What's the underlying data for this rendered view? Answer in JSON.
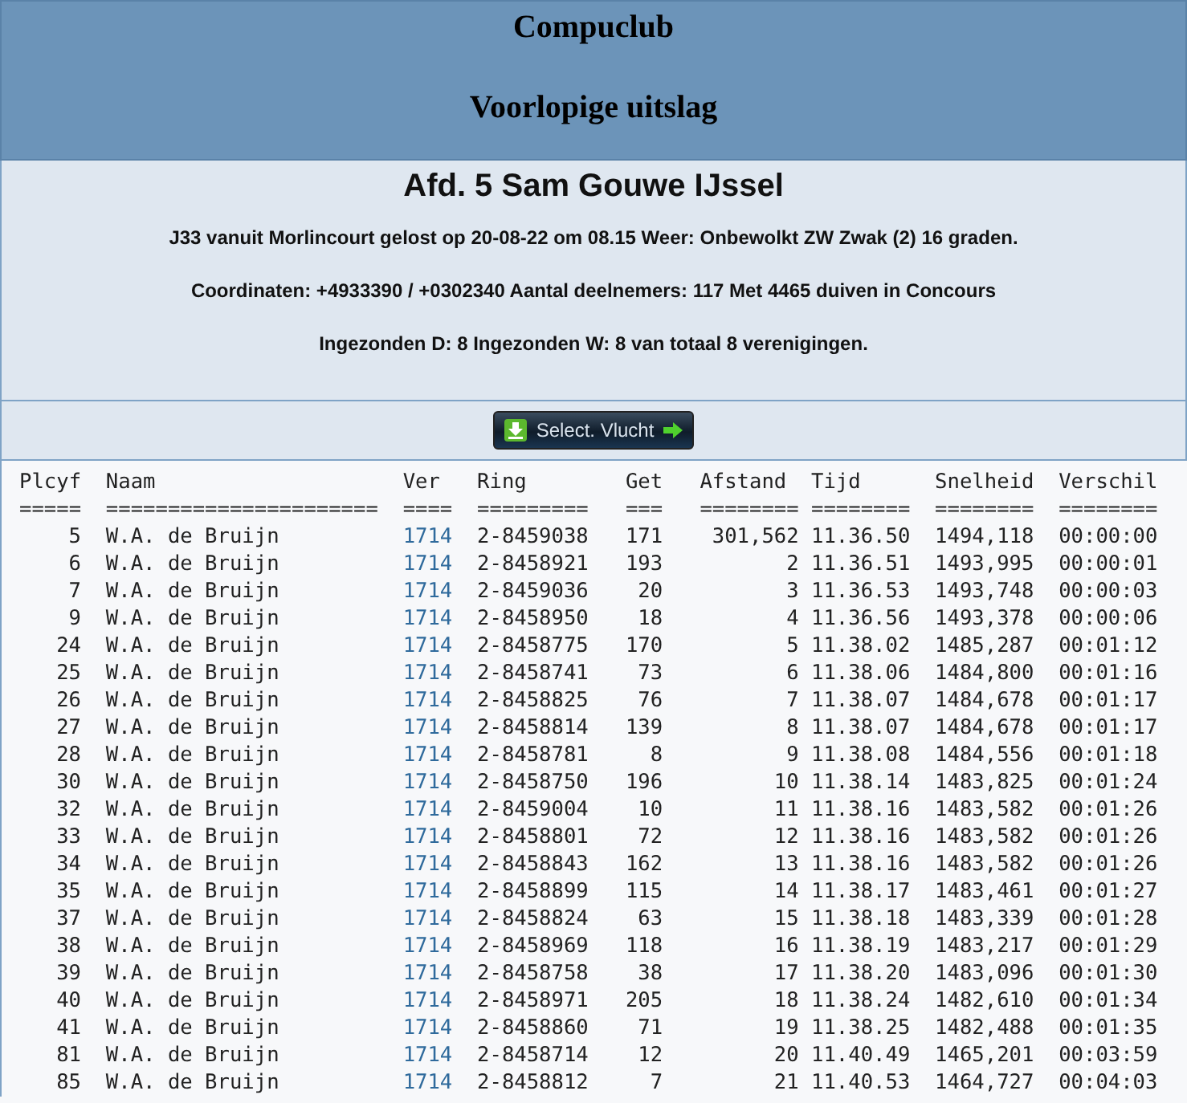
{
  "header": {
    "title": "Compuclub",
    "subtitle": "Voorlopige uitslag"
  },
  "info": {
    "title": "Afd. 5 Sam Gouwe IJssel",
    "lines": [
      "J33 vanuit Morlincourt gelost op 20-08-22 om 08.15 Weer: Onbewolkt ZW Zwak (2) 16 graden.",
      "Coordinaten: +4933390 / +0302340 Aantal deelnemers: 117 Met 4465 duiven in Concours",
      "Ingezonden D: 8 Ingezonden W: 8 van totaal 8 verenigingen."
    ]
  },
  "select_button": {
    "label": "Select. Vlucht"
  },
  "table": {
    "columns": [
      {
        "label": "Plcyf",
        "rule": "=====",
        "kind": "text"
      },
      {
        "label": "Naam",
        "rule": "======================",
        "kind": "text"
      },
      {
        "label": "Ver",
        "rule": "====",
        "kind": "link"
      },
      {
        "label": "Ring",
        "rule": "=========",
        "kind": "text"
      },
      {
        "label": "Get",
        "rule": "===",
        "kind": "text"
      },
      {
        "label": "Afstand",
        "rule": "========",
        "kind": "text"
      },
      {
        "label": "Tijd",
        "rule": "========",
        "kind": "text"
      },
      {
        "label": "Snelheid",
        "rule": "========",
        "kind": "text"
      },
      {
        "label": "Verschil",
        "rule": "========",
        "kind": "text"
      }
    ],
    "rows": [
      [
        "5",
        "W.A. de Bruijn",
        "1714",
        "2-8459038",
        "171",
        "301,562",
        "11.36.50",
        "1494,118",
        "00:00:00"
      ],
      [
        "6",
        "W.A. de Bruijn",
        "1714",
        "2-8458921",
        "193",
        "2",
        "11.36.51",
        "1493,995",
        "00:00:01"
      ],
      [
        "7",
        "W.A. de Bruijn",
        "1714",
        "2-8459036",
        "20",
        "3",
        "11.36.53",
        "1493,748",
        "00:00:03"
      ],
      [
        "9",
        "W.A. de Bruijn",
        "1714",
        "2-8458950",
        "18",
        "4",
        "11.36.56",
        "1493,378",
        "00:00:06"
      ],
      [
        "24",
        "W.A. de Bruijn",
        "1714",
        "2-8458775",
        "170",
        "5",
        "11.38.02",
        "1485,287",
        "00:01:12"
      ],
      [
        "25",
        "W.A. de Bruijn",
        "1714",
        "2-8458741",
        "73",
        "6",
        "11.38.06",
        "1484,800",
        "00:01:16"
      ],
      [
        "26",
        "W.A. de Bruijn",
        "1714",
        "2-8458825",
        "76",
        "7",
        "11.38.07",
        "1484,678",
        "00:01:17"
      ],
      [
        "27",
        "W.A. de Bruijn",
        "1714",
        "2-8458814",
        "139",
        "8",
        "11.38.07",
        "1484,678",
        "00:01:17"
      ],
      [
        "28",
        "W.A. de Bruijn",
        "1714",
        "2-8458781",
        "8",
        "9",
        "11.38.08",
        "1484,556",
        "00:01:18"
      ],
      [
        "30",
        "W.A. de Bruijn",
        "1714",
        "2-8458750",
        "196",
        "10",
        "11.38.14",
        "1483,825",
        "00:01:24"
      ],
      [
        "32",
        "W.A. de Bruijn",
        "1714",
        "2-8459004",
        "10",
        "11",
        "11.38.16",
        "1483,582",
        "00:01:26"
      ],
      [
        "33",
        "W.A. de Bruijn",
        "1714",
        "2-8458801",
        "72",
        "12",
        "11.38.16",
        "1483,582",
        "00:01:26"
      ],
      [
        "34",
        "W.A. de Bruijn",
        "1714",
        "2-8458843",
        "162",
        "13",
        "11.38.16",
        "1483,582",
        "00:01:26"
      ],
      [
        "35",
        "W.A. de Bruijn",
        "1714",
        "2-8458899",
        "115",
        "14",
        "11.38.17",
        "1483,461",
        "00:01:27"
      ],
      [
        "37",
        "W.A. de Bruijn",
        "1714",
        "2-8458824",
        "63",
        "15",
        "11.38.18",
        "1483,339",
        "00:01:28"
      ],
      [
        "38",
        "W.A. de Bruijn",
        "1714",
        "2-8458969",
        "118",
        "16",
        "11.38.19",
        "1483,217",
        "00:01:29"
      ],
      [
        "39",
        "W.A. de Bruijn",
        "1714",
        "2-8458758",
        "38",
        "17",
        "11.38.20",
        "1483,096",
        "00:01:30"
      ],
      [
        "40",
        "W.A. de Bruijn",
        "1714",
        "2-8458971",
        "205",
        "18",
        "11.38.24",
        "1482,610",
        "00:01:34"
      ],
      [
        "41",
        "W.A. de Bruijn",
        "1714",
        "2-8458860",
        "71",
        "19",
        "11.38.25",
        "1482,488",
        "00:01:35"
      ],
      [
        "81",
        "W.A. de Bruijn",
        "1714",
        "2-8458714",
        "12",
        "20",
        "11.40.49",
        "1465,201",
        "00:03:59"
      ],
      [
        "85",
        "W.A. de Bruijn",
        "1714",
        "2-8458812",
        "7",
        "21",
        "11.40.53",
        "1464,727",
        "00:04:03"
      ]
    ]
  }
}
